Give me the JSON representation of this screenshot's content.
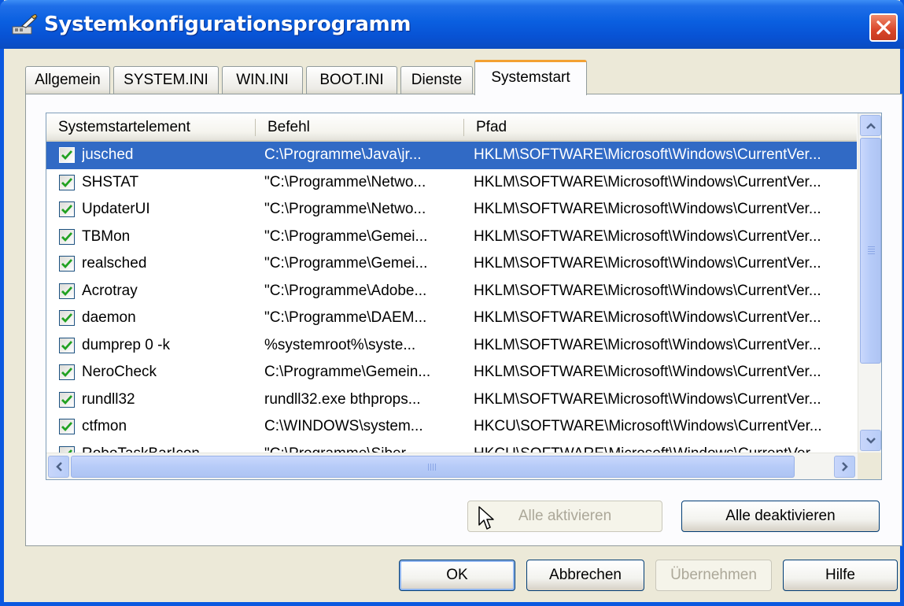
{
  "window": {
    "title": "Systemkonfigurationsprogramm"
  },
  "tabs": [
    {
      "label": "Allgemein",
      "active": false
    },
    {
      "label": "SYSTEM.INI",
      "active": false
    },
    {
      "label": "WIN.INI",
      "active": false
    },
    {
      "label": "BOOT.INI",
      "active": false
    },
    {
      "label": "Dienste",
      "active": false
    },
    {
      "label": "Systemstart",
      "active": true
    }
  ],
  "list": {
    "columns": [
      "Systemstartelement",
      "Befehl",
      "Pfad"
    ],
    "rows": [
      {
        "name": "jusched",
        "command": "C:\\Programme\\Java\\jr...",
        "path": "HKLM\\SOFTWARE\\Microsoft\\Windows\\CurrentVer...",
        "checked": true,
        "selected": true
      },
      {
        "name": "SHSTAT",
        "command": "\"C:\\Programme\\Netwo...",
        "path": "HKLM\\SOFTWARE\\Microsoft\\Windows\\CurrentVer...",
        "checked": true,
        "selected": false
      },
      {
        "name": "UpdaterUI",
        "command": "\"C:\\Programme\\Netwo...",
        "path": "HKLM\\SOFTWARE\\Microsoft\\Windows\\CurrentVer...",
        "checked": true,
        "selected": false
      },
      {
        "name": "TBMon",
        "command": "\"C:\\Programme\\Gemei...",
        "path": "HKLM\\SOFTWARE\\Microsoft\\Windows\\CurrentVer...",
        "checked": true,
        "selected": false
      },
      {
        "name": "realsched",
        "command": "\"C:\\Programme\\Gemei...",
        "path": "HKLM\\SOFTWARE\\Microsoft\\Windows\\CurrentVer...",
        "checked": true,
        "selected": false
      },
      {
        "name": "Acrotray",
        "command": "\"C:\\Programme\\Adobe...",
        "path": "HKLM\\SOFTWARE\\Microsoft\\Windows\\CurrentVer...",
        "checked": true,
        "selected": false
      },
      {
        "name": "daemon",
        "command": "\"C:\\Programme\\DAEM...",
        "path": "HKLM\\SOFTWARE\\Microsoft\\Windows\\CurrentVer...",
        "checked": true,
        "selected": false
      },
      {
        "name": "dumprep 0 -k",
        "command": "%systemroot%\\syste...",
        "path": "HKLM\\SOFTWARE\\Microsoft\\Windows\\CurrentVer...",
        "checked": true,
        "selected": false
      },
      {
        "name": "NeroCheck",
        "command": "C:\\Programme\\Gemein...",
        "path": "HKLM\\SOFTWARE\\Microsoft\\Windows\\CurrentVer...",
        "checked": true,
        "selected": false
      },
      {
        "name": "rundll32",
        "command": "rundll32.exe bthprops...",
        "path": "HKLM\\SOFTWARE\\Microsoft\\Windows\\CurrentVer...",
        "checked": true,
        "selected": false
      },
      {
        "name": "ctfmon",
        "command": "C:\\WINDOWS\\system...",
        "path": "HKCU\\SOFTWARE\\Microsoft\\Windows\\CurrentVer...",
        "checked": true,
        "selected": false
      },
      {
        "name": "RoboTaskBarIcon",
        "command": "\"C:\\Programme\\Siber ...",
        "path": "HKCU\\SOFTWARE\\Microsoft\\Windows\\CurrentVer...",
        "checked": true,
        "selected": false
      }
    ]
  },
  "buttons": {
    "enable_all": "Alle aktivieren",
    "disable_all": "Alle deaktivieren",
    "ok": "OK",
    "cancel": "Abbrechen",
    "apply": "Übernehmen",
    "help": "Hilfe"
  },
  "colors": {
    "titlebar": "#0a5fe0",
    "selection": "#316ac5",
    "active_tab_accent": "#f3a132",
    "checkmark": "#21a121"
  }
}
